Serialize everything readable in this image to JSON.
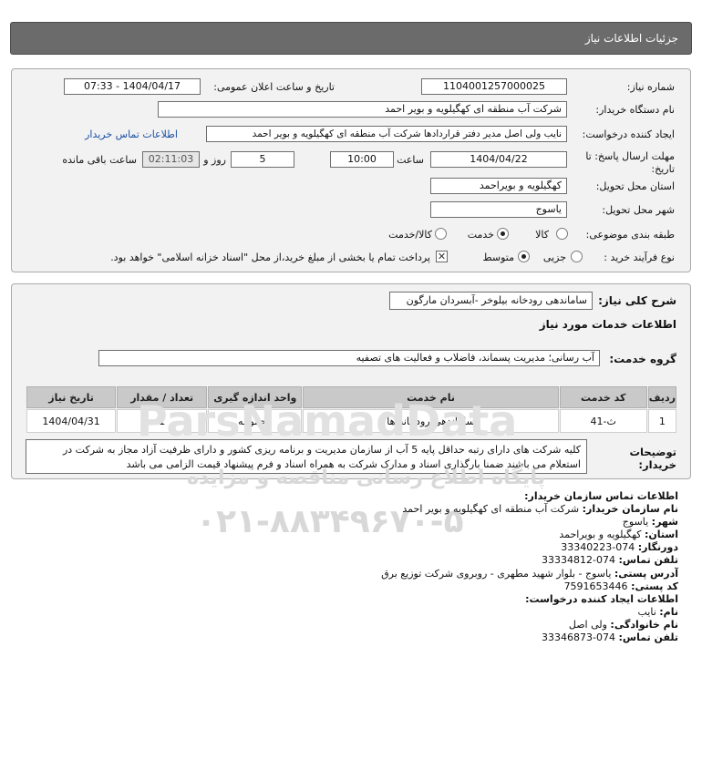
{
  "header": {
    "title": "جزئیات اطلاعات نیاز"
  },
  "need": {
    "number_label": "شماره نیاز:",
    "number_value": "1104001257000025",
    "announce_label": "تاریخ و ساعت اعلان عمومی:",
    "announce_value": "1404/04/17 - 07:33",
    "buyer_label": "نام دستگاه خریدار:",
    "buyer_value": "شرکت آب منطقه ای کهگیلویه و بویر احمد",
    "creator_label": "ایجاد کننده درخواست:",
    "creator_value": "نایب ولی اصل مدیر دفتر قراردادها شرکت آب منطقه ای کهگیلویه و بویر احمد",
    "contact_link": "اطلاعات تماس خریدار",
    "deadline_label_1": "مهلت ارسال پاسخ: تا",
    "deadline_label_2": "تاریخ:",
    "deadline_date": "1404/04/22",
    "time_label": "ساعت",
    "deadline_time": "10:00",
    "days_value": "5",
    "days_label": "روز و",
    "remaining_value": "02:11:03",
    "remaining_label": "ساعت باقی مانده",
    "province_label": "استان محل تحویل:",
    "province_value": "کهگیلویه و بویراحمد",
    "city_label": "شهر محل تحویل:",
    "city_value": "یاسوج",
    "category_label": "طبقه بندی موضوعی:",
    "category_options": [
      "کالا",
      "خدمت",
      "کالا/خدمت"
    ],
    "category_selected": "خدمت",
    "process_label": "نوع فرآیند خرید :",
    "process_options": [
      "جزیی",
      "متوسط"
    ],
    "process_selected": "متوسط",
    "payment_note": "پرداخت تمام یا بخشی از مبلغ خرید،از محل \"اسناد خزانه اسلامی\" خواهد بود."
  },
  "summary": {
    "label": "شرح کلی نیاز:",
    "value": "ساماندهی رودخانه بیلوخر -آبسردان مارگون"
  },
  "services": {
    "section_title": "اطلاعات خدمات مورد نیاز",
    "group_label": "گروه خدمت:",
    "group_value": "آب رسانی؛ مدیریت پسماند، فاضلاب و فعالیت های تصفیه",
    "columns": [
      "ردیف",
      "کد خدمت",
      "نام خدمت",
      "واحد اندازه گیری",
      "تعداد / مقدار",
      "تاریخ نیاز"
    ],
    "rows": [
      [
        "1",
        "ث-41",
        "ساماندهی رودخانه ها",
        "مجموعه",
        "1",
        "1404/04/31"
      ]
    ]
  },
  "notes": {
    "label": "توضیحات خریدار:",
    "value": "کلیه شرکت های دارای رتبه حداقل پایه 5 آب از سازمان مدیریت و برنامه ریزی کشور و دارای ظرفیت آزاد مجاز به شرکت در استعلام می باشند ضمنا بارگذاری اسناد و مدارک شرکت به همراه اسناد و فرم پیشنهاد قیمت الزامی می باشد"
  },
  "contact": {
    "lines": [
      {
        "label": "اطلاعات تماس سازمان خریدار:",
        "value": ""
      },
      {
        "label": "نام سازمان خریدار:",
        "value": "شرکت آب منطقه ای کهگیلویه و بویر احمد"
      },
      {
        "label": "شهر:",
        "value": "یاسوج"
      },
      {
        "label": "استان:",
        "value": "کهگیلویه و بویراحمد"
      },
      {
        "label": "دورنگار:",
        "value": "074-33340223"
      },
      {
        "label": "تلفن تماس:",
        "value": "074-33334812"
      },
      {
        "label": "آدرس پستی:",
        "value": "یاسوج - بلوار شهید مطهری - روبروی شرکت توزیع برق"
      },
      {
        "label": "کد پستی:",
        "value": "7591653446"
      },
      {
        "label": "اطلاعات ایجاد کننده درخواست:",
        "value": ""
      },
      {
        "label": "نام:",
        "value": "نایب"
      },
      {
        "label": "نام خانوادگی:",
        "value": "ولی اصل"
      },
      {
        "label": "تلفن تماس:",
        "value": "074-33346873"
      }
    ]
  },
  "watermark": {
    "brand": "ParsNamadData",
    "persian": "پایگاه اطلاع رسانی مناقصه و مزایده",
    "phone": "۰۲۱-۸۸۳۴۹۶۷۰-۵"
  },
  "colors": {
    "header": "#6b6b6b",
    "panel": "#f2f2f2",
    "table_header": "#c9c9c9",
    "link": "#1a4fa3"
  }
}
